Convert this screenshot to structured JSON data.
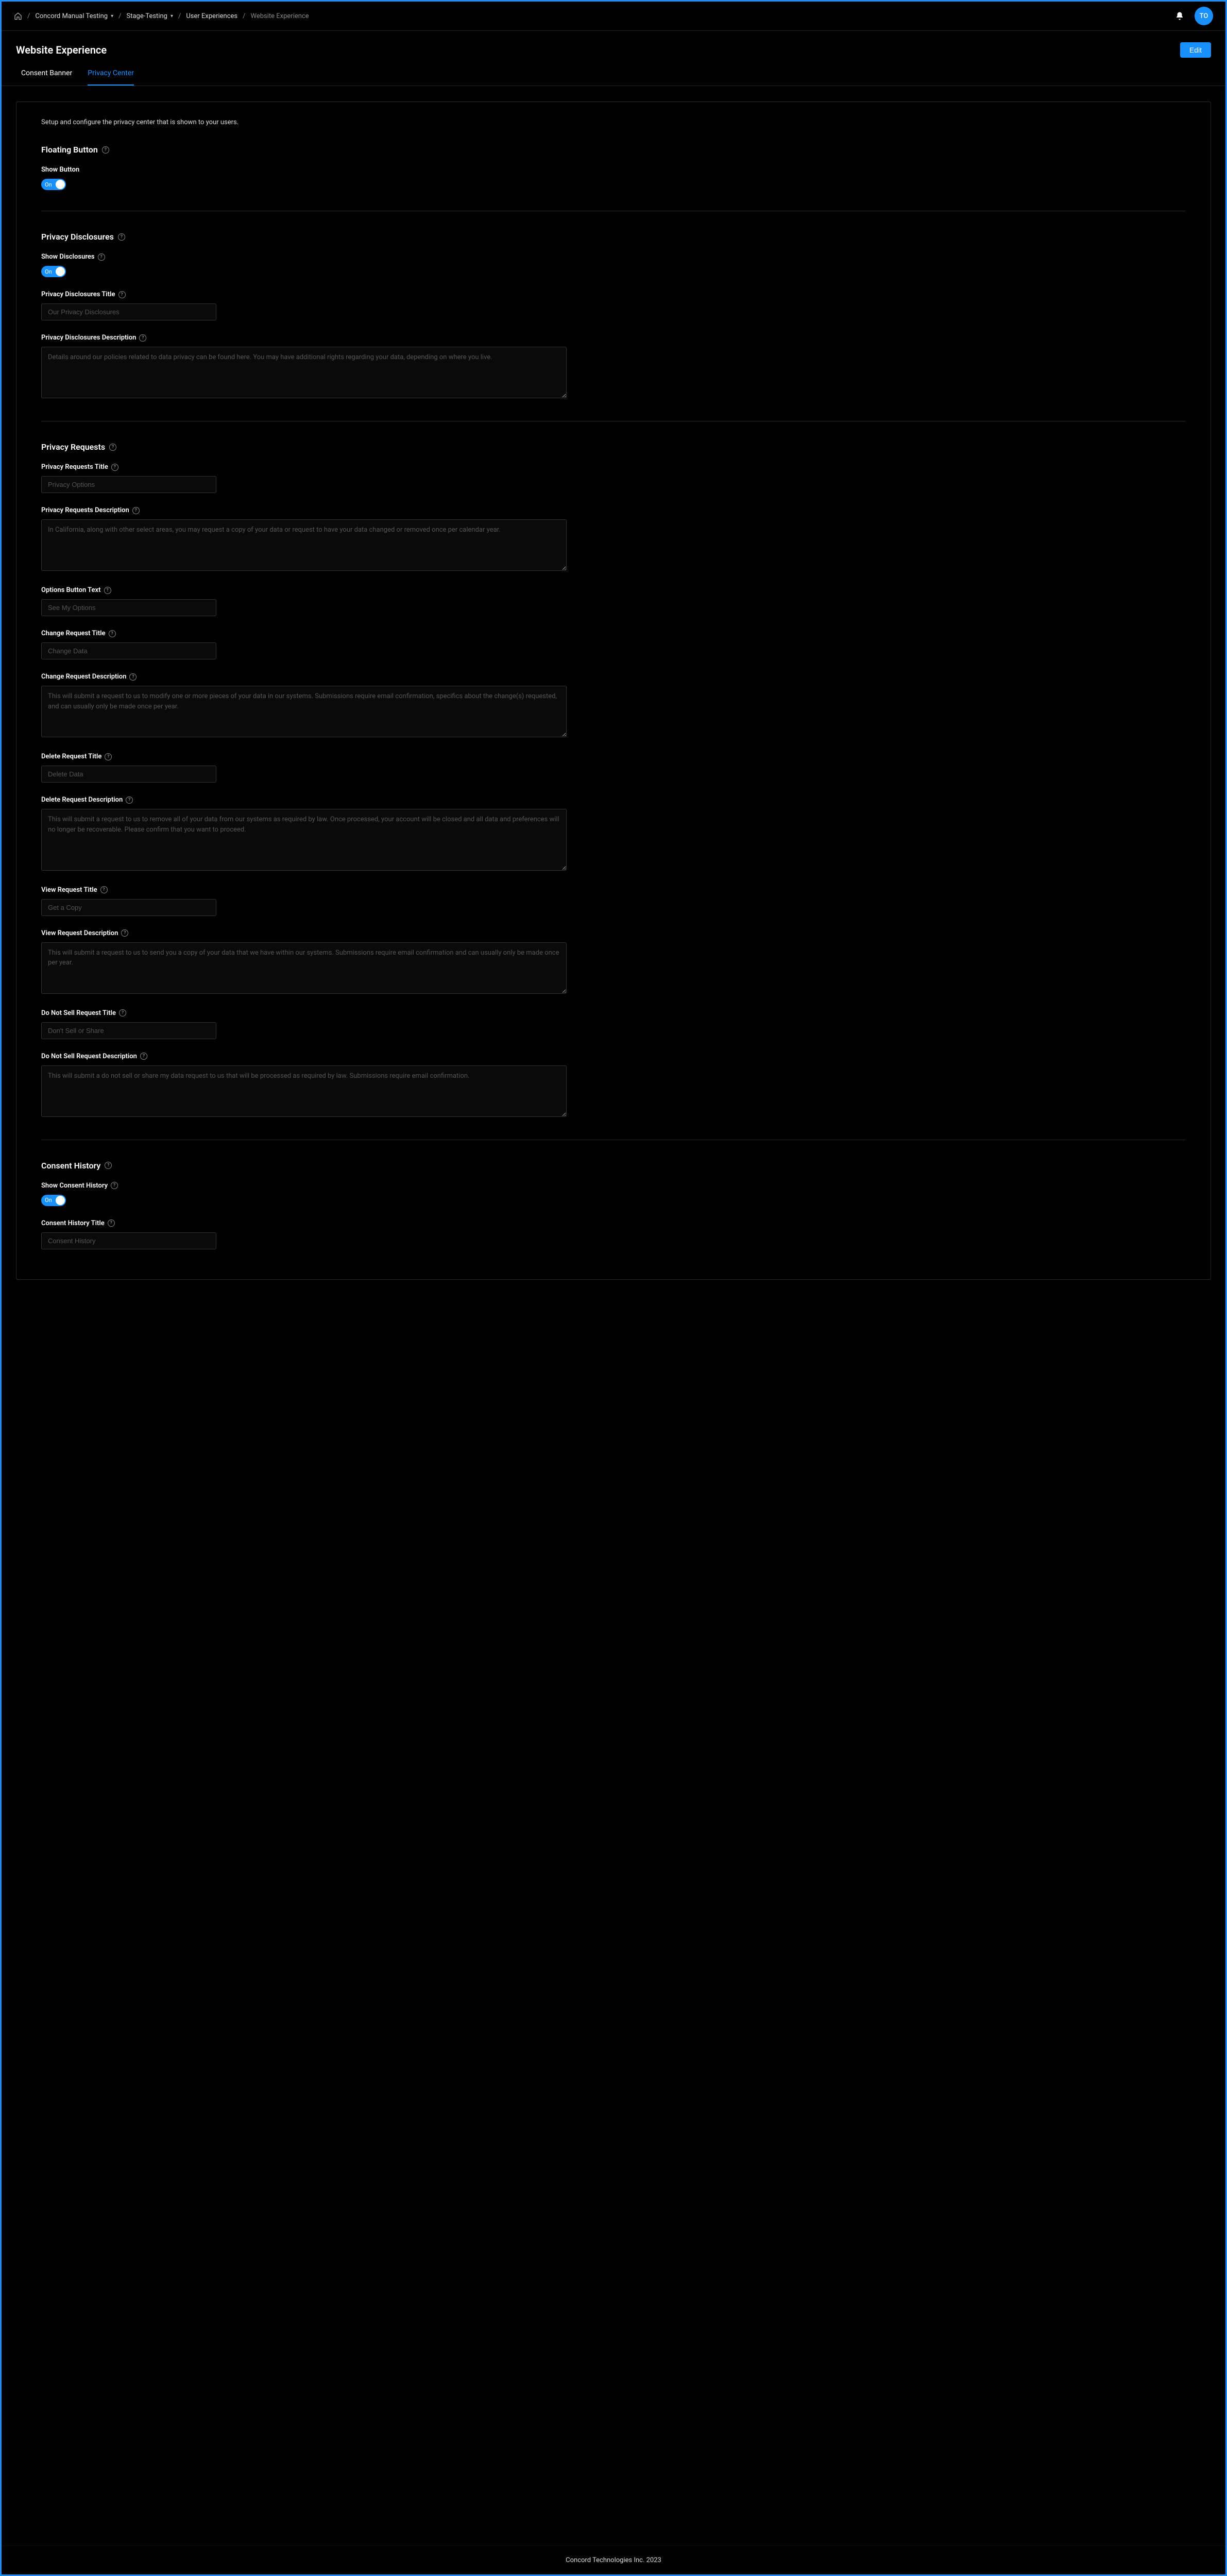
{
  "breadcrumb": {
    "items": [
      {
        "label": "Concord Manual Testing",
        "dropdown": true
      },
      {
        "label": "Stage-Testing",
        "dropdown": true
      },
      {
        "label": "User Experiences",
        "dropdown": false
      },
      {
        "label": "Website Experience",
        "dropdown": false,
        "muted": true
      }
    ]
  },
  "avatar": {
    "initials": "TO"
  },
  "page": {
    "title": "Website Experience",
    "edit_label": "Edit"
  },
  "tabs": [
    {
      "label": "Consent Banner",
      "active": false
    },
    {
      "label": "Privacy Center",
      "active": true
    }
  ],
  "intro": "Setup and configure the privacy center that is shown to your users.",
  "sections": {
    "floating_button": {
      "heading": "Floating Button",
      "show_button_label": "Show Button",
      "show_button_state": "On"
    },
    "privacy_disclosures": {
      "heading": "Privacy Disclosures",
      "show_disclosures_label": "Show Disclosures",
      "show_disclosures_state": "On",
      "title_label": "Privacy Disclosures Title",
      "title_placeholder": "Our Privacy Disclosures",
      "desc_label": "Privacy Disclosures Description",
      "desc_placeholder": "Details around our policies related to data privacy can be found here. You may have additional rights regarding your data, depending on where you live."
    },
    "privacy_requests": {
      "heading": "Privacy Requests",
      "title_label": "Privacy Requests Title",
      "title_placeholder": "Privacy Options",
      "desc_label": "Privacy Requests Description",
      "desc_placeholder": "In California, along with other select areas, you may request a copy of your data or request to have your data changed or removed once per calendar year.",
      "options_btn_label": "Options Button Text",
      "options_btn_placeholder": "See My Options",
      "change_title_label": "Change Request Title",
      "change_title_placeholder": "Change Data",
      "change_desc_label": "Change Request Description",
      "change_desc_placeholder": "This will submit a request to us to modify one or more pieces of your data in our systems. Submissions require email confirmation, specifics about the change(s) requested, and can usually only be made once per year.",
      "delete_title_label": "Delete Request Title",
      "delete_title_placeholder": "Delete Data",
      "delete_desc_label": "Delete Request Description",
      "delete_desc_placeholder": "This will submit a request to us to remove all of your data from our systems as required by law. Once processed, your account will be closed and all data and preferences will no longer be recoverable. Please confirm that you want to proceed.",
      "view_title_label": "View Request Title",
      "view_title_placeholder": "Get a Copy",
      "view_desc_label": "View Request Description",
      "view_desc_placeholder": "This will submit a request to us to send you a copy of your data that we have within our systems. Submissions require email confirmation and can usually only be made once per year.",
      "dns_title_label": "Do Not Sell Request Title",
      "dns_title_placeholder": "Don't Sell or Share",
      "dns_desc_label": "Do Not Sell Request Description",
      "dns_desc_placeholder": "This will submit a do not sell or share my data request to us that will be processed as required by law. Submissions require email confirmation."
    },
    "consent_history": {
      "heading": "Consent History",
      "show_label": "Show Consent History",
      "show_state": "On",
      "title_label": "Consent History Title",
      "title_placeholder": "Consent History"
    }
  },
  "footer": "Concord Technologies Inc. 2023"
}
